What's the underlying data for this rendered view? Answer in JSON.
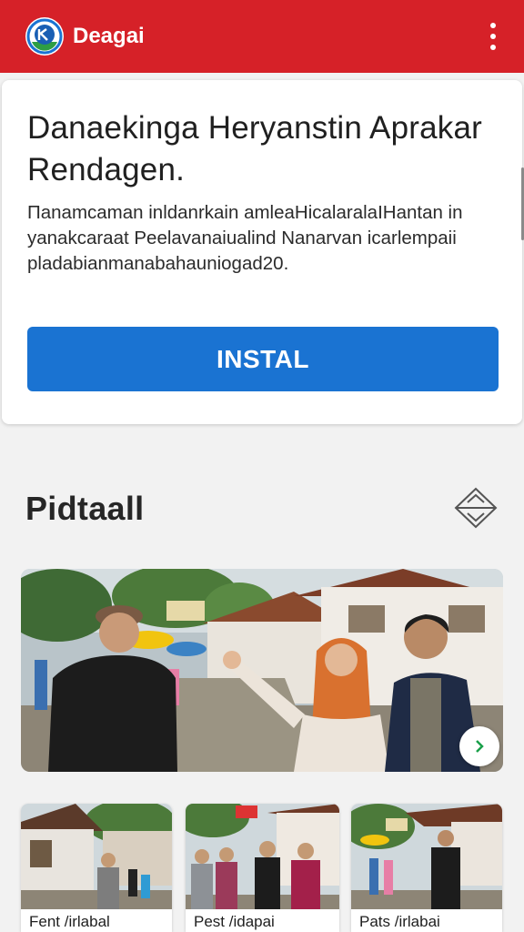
{
  "app_bar": {
    "title": "Deagai",
    "logo_icon": "app-logo-icon",
    "menu_icon": "more-vert-icon",
    "background_color": "#d62128"
  },
  "promo_card": {
    "title": "Danaekinga Heryanstin Aprakar Rendagen.",
    "description": "Паnamcaman inldanrkain amleaHicalaralaIHantan in yanakcaraat Peelavanaiualind Nanarvan icarlempaii pladabianmanabahauniogad20.",
    "install_label": "INSTAL",
    "accent_color": "#1a73d2"
  },
  "section": {
    "title": "Pidtaall",
    "icon": "expand-diamond-icon"
  },
  "gallery": {
    "main_photo_icon": "group-photo-village",
    "next_icon": "chevron-right-icon",
    "thumbnails": [
      {
        "label": "Fent /irlabal"
      },
      {
        "label": "Pest /idapai"
      },
      {
        "label": "Pats /irlabai"
      }
    ]
  }
}
